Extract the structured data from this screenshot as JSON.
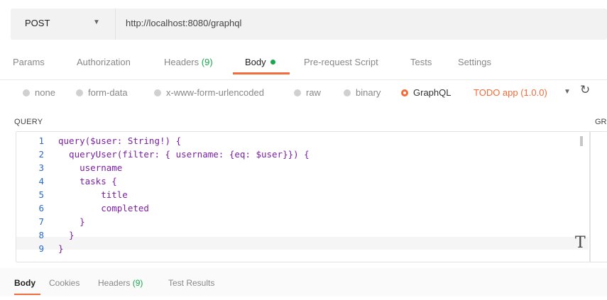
{
  "request": {
    "method": "POST",
    "url": "http://localhost:8080/graphql"
  },
  "tabs": [
    {
      "label": "Params"
    },
    {
      "label": "Authorization"
    },
    {
      "label": "Headers",
      "count": "(9)"
    },
    {
      "label": "Body"
    },
    {
      "label": "Pre-request Script"
    },
    {
      "label": "Tests"
    },
    {
      "label": "Settings"
    }
  ],
  "body_types": [
    {
      "label": "none"
    },
    {
      "label": "form-data"
    },
    {
      "label": "x-www-form-urlencoded"
    },
    {
      "label": "raw"
    },
    {
      "label": "binary"
    },
    {
      "label": "GraphQL"
    }
  ],
  "schema": {
    "label": "TODO app (1.0.0)"
  },
  "query": {
    "title": "QUERY",
    "side_title": "GR",
    "lines": [
      {
        "num": "1",
        "text": "query($user: String!) {"
      },
      {
        "num": "2",
        "text": "  queryUser(filter: { username: {eq: $user}}) {"
      },
      {
        "num": "3",
        "text": "    username"
      },
      {
        "num": "4",
        "text": "    tasks {"
      },
      {
        "num": "5",
        "text": "        title"
      },
      {
        "num": "6",
        "text": "        completed"
      },
      {
        "num": "7",
        "text": "    }"
      },
      {
        "num": "8",
        "text": "  }"
      },
      {
        "num": "9",
        "text": "}"
      }
    ]
  },
  "response_tabs": [
    {
      "label": "Body"
    },
    {
      "label": "Cookies"
    },
    {
      "label": "Headers",
      "count": "(9)"
    },
    {
      "label": "Test Results"
    }
  ],
  "colors": {
    "accent": "#f26b3a",
    "green": "#1aa84f",
    "line_number": "#2a6ac9",
    "code": "#7a1fa2"
  }
}
